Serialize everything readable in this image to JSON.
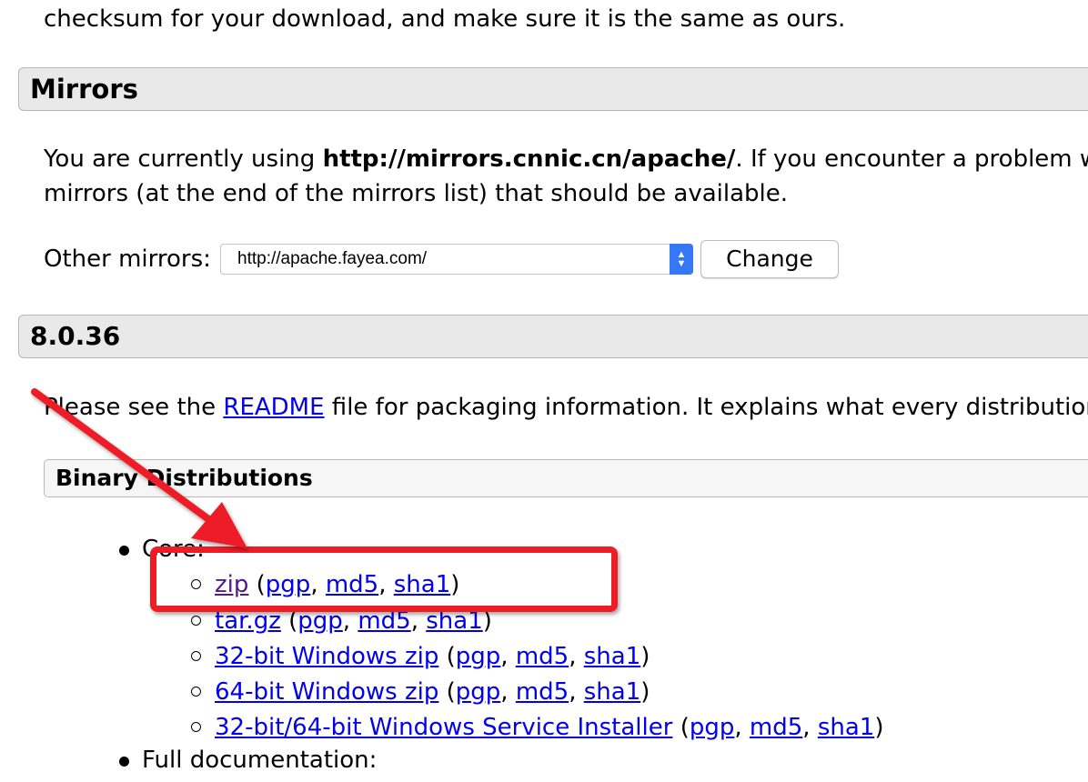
{
  "intro": {
    "checksum_text": "checksum for your download, and make sure it is the same as ours."
  },
  "mirrors": {
    "heading": "Mirrors",
    "current_prefix": "You are currently using ",
    "current_mirror": "http://mirrors.cnnic.cn/apache/",
    "current_suffix": ". If you encounter a problem w",
    "line2": "mirrors (at the end of the mirrors list) that should be available.",
    "other_label": "Other mirrors:",
    "select_value": "http://apache.fayea.com/",
    "change_button": "Change"
  },
  "version": {
    "heading": "8.0.36",
    "readme_prefix": "Please see the ",
    "readme_link": "README",
    "readme_suffix": " file for packaging information. It explains what every distributior"
  },
  "binary": {
    "heading": "Binary Distributions",
    "core_label": "Core:",
    "full_docs_label": "Full documentation:",
    "items": [
      {
        "name": "zip",
        "pgp": "pgp",
        "md5": "md5",
        "sha1": "sha1"
      },
      {
        "name": "tar.gz",
        "pgp": "pgp",
        "md5": "md5",
        "sha1": "sha1"
      },
      {
        "name": "32-bit Windows zip",
        "pgp": "pgp",
        "md5": "md5",
        "sha1": "sha1"
      },
      {
        "name": "64-bit Windows zip",
        "pgp": "pgp",
        "md5": "md5",
        "sha1": "sha1"
      },
      {
        "name": "32-bit/64-bit Windows Service Installer",
        "pgp": "pgp",
        "md5": "md5",
        "sha1": "sha1"
      }
    ]
  },
  "punct": {
    "open": " (",
    "comma": ", ",
    "close": ")"
  },
  "colors": {
    "link": "#0000ee",
    "visited_link": "#551a8b",
    "annotation_red": "#ee1c25",
    "heading_bar": "#e9e9e9",
    "select_arrow": "#3478f6"
  },
  "icons": {
    "annotation": "red-arrow-icon",
    "select": "chevron-updown-icon"
  }
}
